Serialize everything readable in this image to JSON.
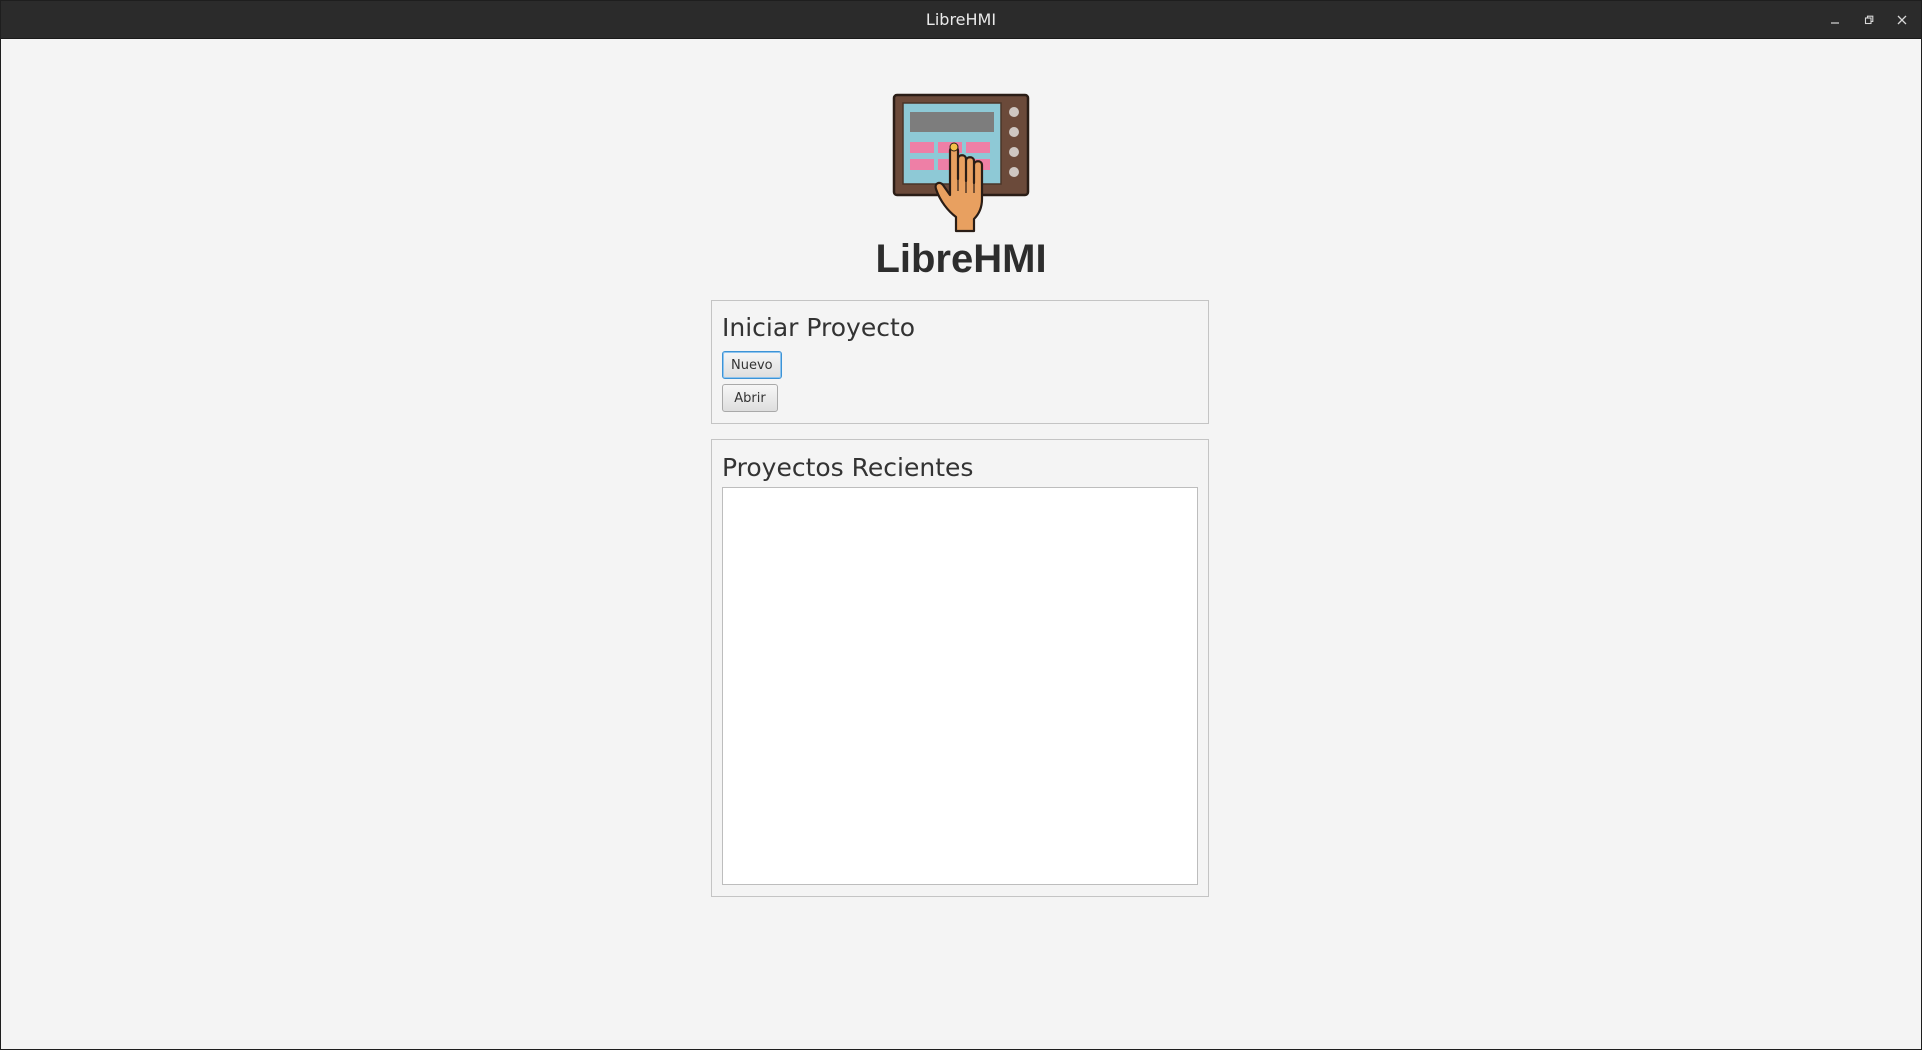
{
  "window": {
    "title": "LibreHMI",
    "controls": {
      "minimize_icon": "minimize-icon",
      "maximize_icon": "restore-icon",
      "close_icon": "close-icon"
    }
  },
  "branding": {
    "logo_icon": "hmi-touch-panel-icon",
    "app_name": "LibreHMI"
  },
  "start_project": {
    "title": "Iniciar Proyecto",
    "new_label": "Nuevo",
    "open_label": "Abrir"
  },
  "recent_projects": {
    "title": "Proyectos Recientes",
    "items": []
  },
  "colors": {
    "titlebar": "#2b2b2b",
    "background": "#f4f4f4",
    "focus_accent": "#3c93d6",
    "logo_frame": "#6b4a3a",
    "logo_screen": "#8ec9d6",
    "logo_keys": "#ee7fa6",
    "logo_hand": "#e8a060"
  }
}
